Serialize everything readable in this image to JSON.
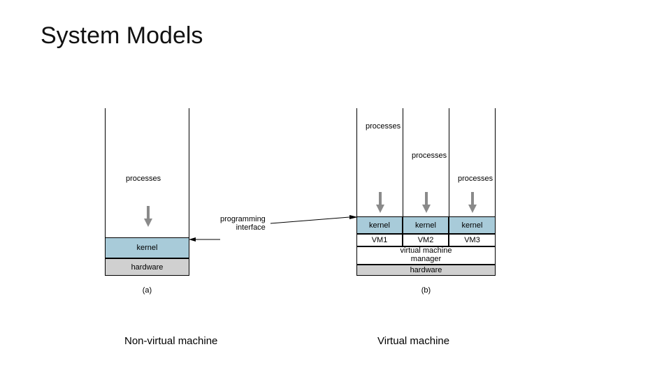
{
  "title": "System Models",
  "figure_a": {
    "processes_label": "processes",
    "kernel_label": "kernel",
    "hardware_label": "hardware",
    "caption": "(a)"
  },
  "interface_label": "programming\ninterface",
  "figure_b": {
    "col0": {
      "processes": "processes",
      "kernel": "kernel",
      "vm": "VM1"
    },
    "col1": {
      "processes": "processes",
      "kernel": "kernel",
      "vm": "VM2"
    },
    "col2": {
      "processes": "processes",
      "kernel": "kernel",
      "vm": "VM3"
    },
    "vmm_label": "virtual machine\nmanager",
    "hardware_label": "hardware",
    "caption": "(b)"
  },
  "bottom": {
    "left": "Non-virtual machine",
    "right": "Virtual machine"
  }
}
